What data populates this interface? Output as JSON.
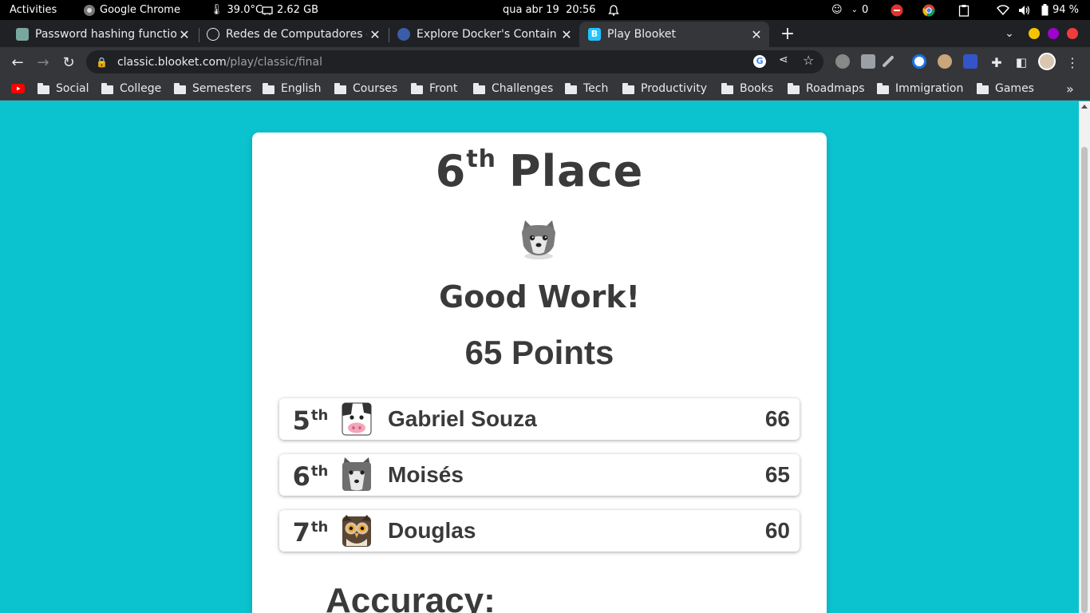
{
  "system_bar": {
    "activities": "Activities",
    "app_name": "Google Chrome",
    "temperature": "39.0°C",
    "memory": "2.62 GB",
    "clock": "qua abr 19  20:56",
    "notif_count": "0",
    "battery": "94 %"
  },
  "tabs": [
    {
      "title": "Password hashing functio",
      "color": "#7aa6a0"
    },
    {
      "title": "Redes de Computadores e",
      "color": "#9aa0a6"
    },
    {
      "title": "Explore Docker's Contain",
      "color": "#3a5da8"
    },
    {
      "title": "Play Blooket",
      "color": "#1ec6ff"
    }
  ],
  "toolbar": {
    "url_host": "classic.blooket.com",
    "url_path": "/play/classic/final"
  },
  "bookmarks": [
    "Social",
    "College",
    "Semesters",
    "English",
    "Courses",
    "Front",
    "Challenges",
    "Tech",
    "Productivity",
    "Books",
    "Roadmaps",
    "Immigration",
    "Games"
  ],
  "result": {
    "place_number": "6",
    "place_suffix": "th",
    "place_word": "Place",
    "message": "Good Work!",
    "points": "65 Points",
    "accuracy_label": "Accuracy:"
  },
  "leaderboard": [
    {
      "rank": "5",
      "suffix": "th",
      "name": "Gabriel Souza",
      "score": "66",
      "avatar": "cow-avatar"
    },
    {
      "rank": "6",
      "suffix": "th",
      "name": "Moisés",
      "score": "65",
      "avatar": "wolf-avatar"
    },
    {
      "rank": "7",
      "suffix": "th",
      "name": "Douglas",
      "score": "60",
      "avatar": "owl-avatar"
    }
  ],
  "colors": {
    "page_bg": "#0bc2cf",
    "text": "#3a3a3a"
  }
}
